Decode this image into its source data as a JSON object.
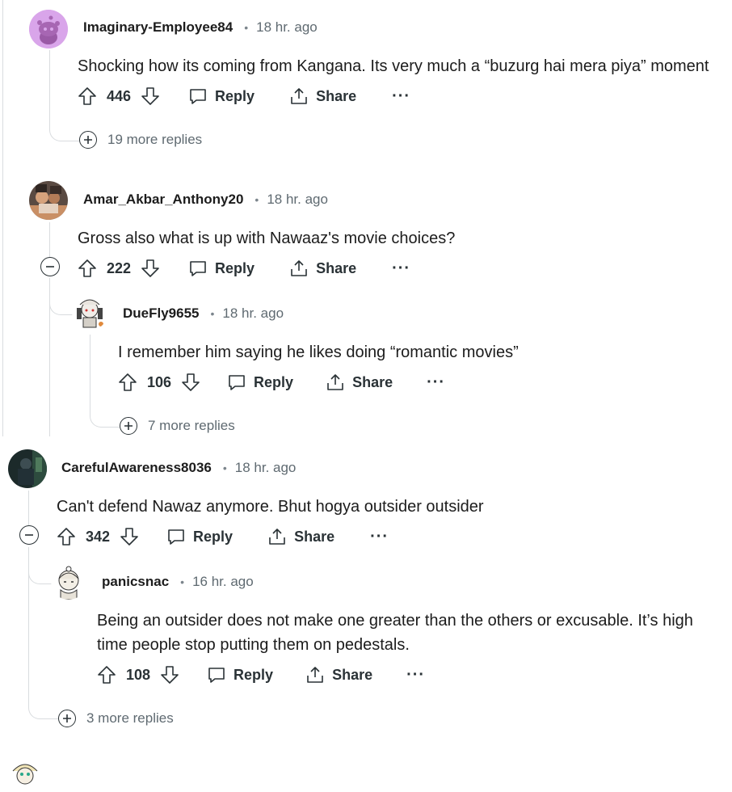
{
  "icons": {
    "upvote": "arrow-up-icon",
    "downvote": "arrow-down-icon",
    "reply": "speech-bubble-icon",
    "share": "share-icon",
    "more": "ellipsis-icon",
    "expand": "plus-circle-icon",
    "collapse": "minus-circle-icon"
  },
  "labels": {
    "reply": "Reply",
    "share": "Share",
    "more": "···"
  },
  "comments": [
    {
      "author": "Imaginary-Employee84",
      "time": "18 hr. ago",
      "text": "Shocking how its coming from Kangana. Its very much a “buzurg hai mera piya” moment",
      "score": "446",
      "more_replies": "19 more replies"
    },
    {
      "author": "Amar_Akbar_Anthony20",
      "time": "18 hr. ago",
      "text": "Gross also what is up with Nawaaz's movie choices?",
      "score": "222"
    },
    {
      "author": "DueFly9655",
      "time": "18 hr. ago",
      "text": "I remember him saying he likes doing “romantic movies”",
      "score": "106",
      "more_replies": "7 more replies"
    },
    {
      "author": "CarefulAwareness8036",
      "time": "18 hr. ago",
      "text": "Can't defend Nawaz anymore. Bhut hogya outsider outsider",
      "score": "342"
    },
    {
      "author": "panicsnac",
      "time": "16 hr. ago",
      "text": "Being an outsider does not make one greater than the others or excusable. It’s high time people stop putting them on pedestals.",
      "score": "108",
      "more_replies": "3 more replies"
    }
  ]
}
